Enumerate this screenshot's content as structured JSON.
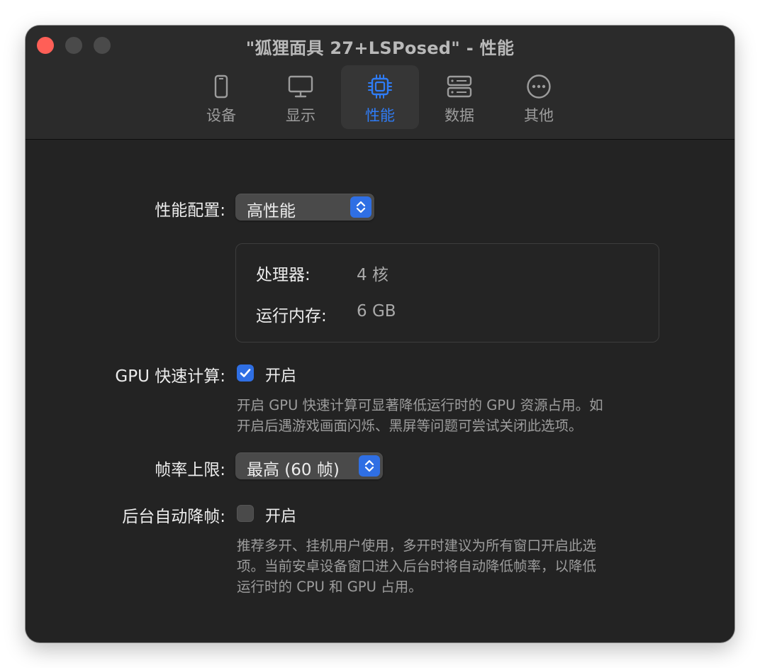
{
  "window": {
    "title": "\"狐狸面具 27+LSPosed\" - 性能"
  },
  "toolbar": {
    "tabs": [
      {
        "label": "设备",
        "icon": "phone-icon"
      },
      {
        "label": "显示",
        "icon": "monitor-icon"
      },
      {
        "label": "性能",
        "icon": "chip-icon",
        "active": true
      },
      {
        "label": "数据",
        "icon": "storage-icon"
      },
      {
        "label": "其他",
        "icon": "more-icon"
      }
    ]
  },
  "performance": {
    "profile_label": "性能配置:",
    "profile_value": "高性能",
    "processor_label": "处理器:",
    "processor_value": "4 核",
    "memory_label": "运行内存:",
    "memory_value": "6 GB"
  },
  "gpu": {
    "label": "GPU 快速计算:",
    "checkbox_label": "开启",
    "checked": true,
    "help_line1": "开启 GPU 快速计算可显著降低运行时的 GPU 资源占用。如",
    "help_line2": "开启后遇游戏画面闪烁、黑屏等问题可尝试关闭此选项。"
  },
  "framerate": {
    "label": "帧率上限:",
    "value": "最高 (60 帧)"
  },
  "background": {
    "label": "后台自动降帧:",
    "checkbox_label": "开启",
    "checked": false,
    "help_line1": "推荐多开、挂机用户使用，多开时建议为所有窗口开启此选",
    "help_line2": "项。当前安卓设备窗口进入后台时将自动降低帧率，以降低",
    "help_line3": "运行时的 CPU 和 GPU 占用。"
  },
  "colors": {
    "accent": "#2f7cf6",
    "window_bg": "#232323",
    "close_button": "#ff5f57"
  }
}
